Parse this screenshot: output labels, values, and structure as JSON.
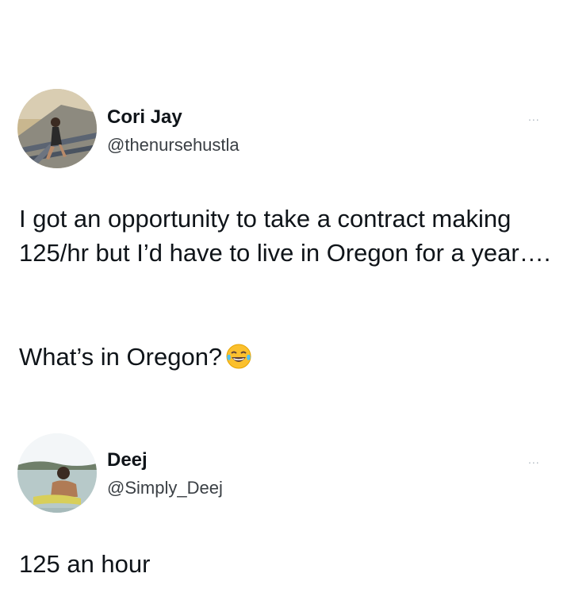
{
  "tweets": [
    {
      "display_name": "Cori Jay",
      "handle": "@thenursehustla",
      "more_label": "...",
      "paragraphs": [
        "I got an opportunity to take a contract making 125/hr but I’d have to live in Oregon for a year….",
        "What’s in Oregon?"
      ],
      "emoji": "face-with-tears-of-joy-icon"
    },
    {
      "display_name": "Deej",
      "handle": "@Simply_Deej",
      "more_label": "...",
      "paragraphs": [
        "125 an hour"
      ]
    }
  ],
  "colors": {
    "background": "#ffffff",
    "text": "#0f1419",
    "secondary_text": "#3a3f44",
    "more_dots": "#aab4bd"
  }
}
